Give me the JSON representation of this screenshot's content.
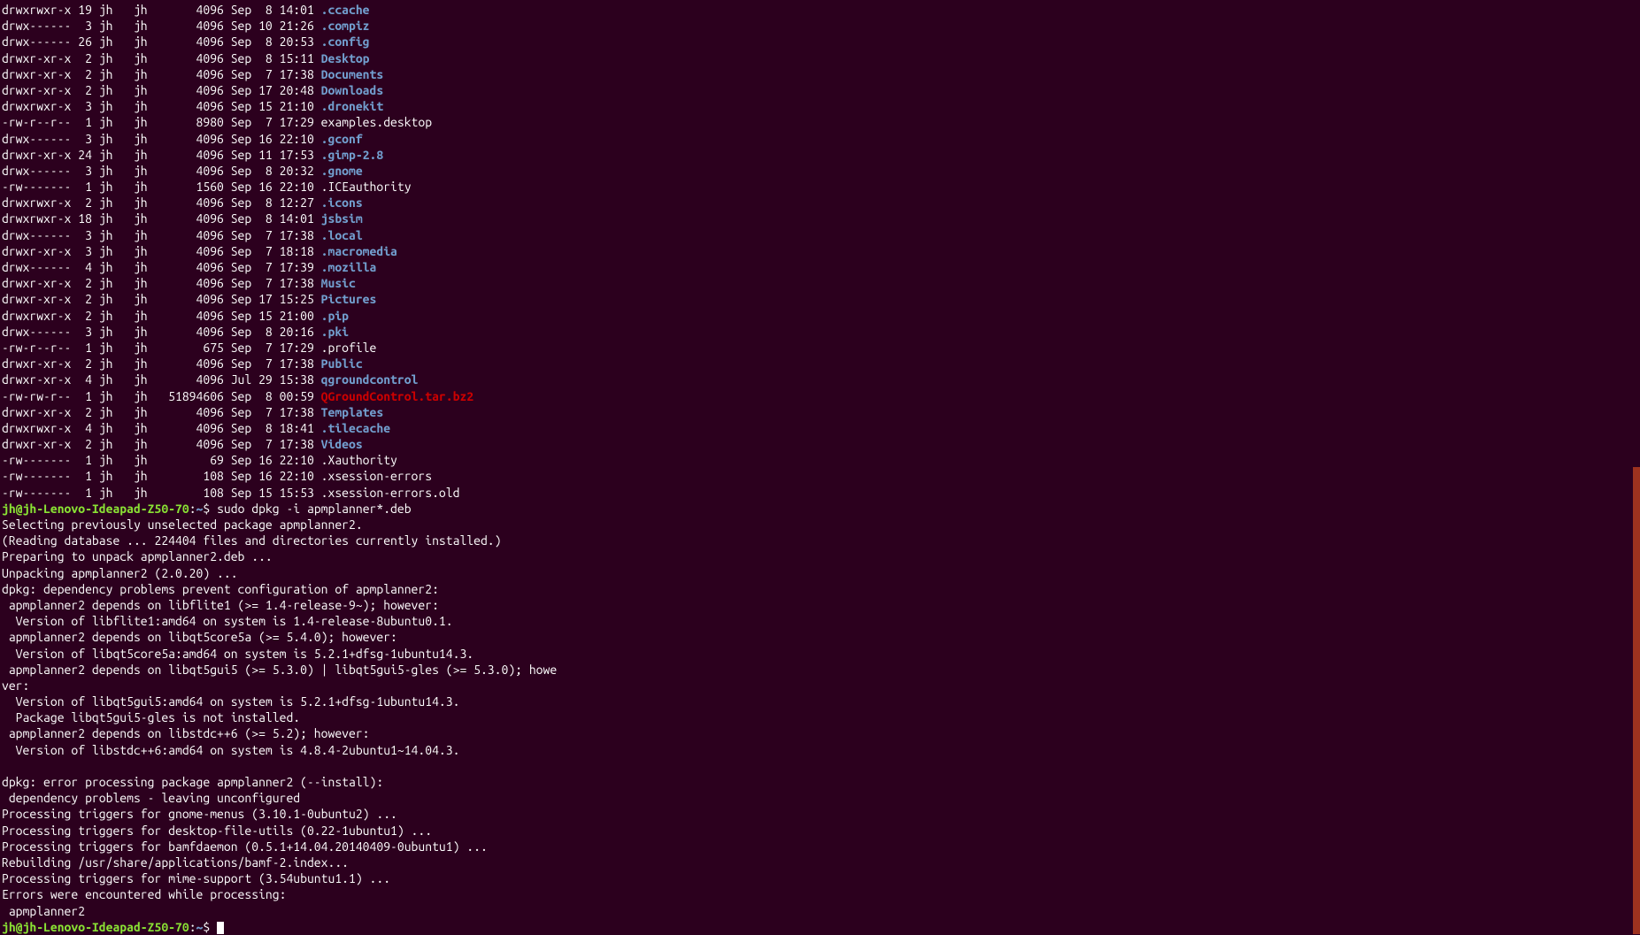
{
  "ls_entries": [
    {
      "perms": "drwxrwxr-x",
      "links": "19",
      "owner": "jh",
      "group": "jh",
      "size": "4096",
      "date": "Sep  8 14:01",
      "name": ".ccache",
      "type": "dir"
    },
    {
      "perms": "drwx------",
      "links": "3",
      "owner": "jh",
      "group": "jh",
      "size": "4096",
      "date": "Sep 10 21:26",
      "name": ".compiz",
      "type": "dir"
    },
    {
      "perms": "drwx------",
      "links": "26",
      "owner": "jh",
      "group": "jh",
      "size": "4096",
      "date": "Sep  8 20:53",
      "name": ".config",
      "type": "dir"
    },
    {
      "perms": "drwxr-xr-x",
      "links": "2",
      "owner": "jh",
      "group": "jh",
      "size": "4096",
      "date": "Sep  8 15:11",
      "name": "Desktop",
      "type": "dir"
    },
    {
      "perms": "drwxr-xr-x",
      "links": "2",
      "owner": "jh",
      "group": "jh",
      "size": "4096",
      "date": "Sep  7 17:38",
      "name": "Documents",
      "type": "dir"
    },
    {
      "perms": "drwxr-xr-x",
      "links": "2",
      "owner": "jh",
      "group": "jh",
      "size": "4096",
      "date": "Sep 17 20:48",
      "name": "Downloads",
      "type": "dir"
    },
    {
      "perms": "drwxrwxr-x",
      "links": "3",
      "owner": "jh",
      "group": "jh",
      "size": "4096",
      "date": "Sep 15 21:10",
      "name": ".dronekit",
      "type": "dir"
    },
    {
      "perms": "-rw-r--r--",
      "links": "1",
      "owner": "jh",
      "group": "jh",
      "size": "8980",
      "date": "Sep  7 17:29",
      "name": "examples.desktop",
      "type": "file"
    },
    {
      "perms": "drwx------",
      "links": "3",
      "owner": "jh",
      "group": "jh",
      "size": "4096",
      "date": "Sep 16 22:10",
      "name": ".gconf",
      "type": "dir"
    },
    {
      "perms": "drwxr-xr-x",
      "links": "24",
      "owner": "jh",
      "group": "jh",
      "size": "4096",
      "date": "Sep 11 17:53",
      "name": ".gimp-2.8",
      "type": "dir"
    },
    {
      "perms": "drwx------",
      "links": "3",
      "owner": "jh",
      "group": "jh",
      "size": "4096",
      "date": "Sep  8 20:32",
      "name": ".gnome",
      "type": "dir"
    },
    {
      "perms": "-rw-------",
      "links": "1",
      "owner": "jh",
      "group": "jh",
      "size": "1560",
      "date": "Sep 16 22:10",
      "name": ".ICEauthority",
      "type": "file"
    },
    {
      "perms": "drwxrwxr-x",
      "links": "2",
      "owner": "jh",
      "group": "jh",
      "size": "4096",
      "date": "Sep  8 12:27",
      "name": ".icons",
      "type": "dir"
    },
    {
      "perms": "drwxrwxr-x",
      "links": "18",
      "owner": "jh",
      "group": "jh",
      "size": "4096",
      "date": "Sep  8 14:01",
      "name": "jsbsim",
      "type": "dir"
    },
    {
      "perms": "drwx------",
      "links": "3",
      "owner": "jh",
      "group": "jh",
      "size": "4096",
      "date": "Sep  7 17:38",
      "name": ".local",
      "type": "dir"
    },
    {
      "perms": "drwxr-xr-x",
      "links": "3",
      "owner": "jh",
      "group": "jh",
      "size": "4096",
      "date": "Sep  7 18:18",
      "name": ".macromedia",
      "type": "dir"
    },
    {
      "perms": "drwx------",
      "links": "4",
      "owner": "jh",
      "group": "jh",
      "size": "4096",
      "date": "Sep  7 17:39",
      "name": ".mozilla",
      "type": "dir"
    },
    {
      "perms": "drwxr-xr-x",
      "links": "2",
      "owner": "jh",
      "group": "jh",
      "size": "4096",
      "date": "Sep  7 17:38",
      "name": "Music",
      "type": "dir"
    },
    {
      "perms": "drwxr-xr-x",
      "links": "2",
      "owner": "jh",
      "group": "jh",
      "size": "4096",
      "date": "Sep 17 15:25",
      "name": "Pictures",
      "type": "dir"
    },
    {
      "perms": "drwxrwxr-x",
      "links": "2",
      "owner": "jh",
      "group": "jh",
      "size": "4096",
      "date": "Sep 15 21:00",
      "name": ".pip",
      "type": "dir"
    },
    {
      "perms": "drwx------",
      "links": "3",
      "owner": "jh",
      "group": "jh",
      "size": "4096",
      "date": "Sep  8 20:16",
      "name": ".pki",
      "type": "dir"
    },
    {
      "perms": "-rw-r--r--",
      "links": "1",
      "owner": "jh",
      "group": "jh",
      "size": "675",
      "date": "Sep  7 17:29",
      "name": ".profile",
      "type": "file"
    },
    {
      "perms": "drwxr-xr-x",
      "links": "2",
      "owner": "jh",
      "group": "jh",
      "size": "4096",
      "date": "Sep  7 17:38",
      "name": "Public",
      "type": "dir"
    },
    {
      "perms": "drwxr-xr-x",
      "links": "4",
      "owner": "jh",
      "group": "jh",
      "size": "4096",
      "date": "Jul 29 15:38",
      "name": "qgroundcontrol",
      "type": "dir"
    },
    {
      "perms": "-rw-rw-r--",
      "links": "1",
      "owner": "jh",
      "group": "jh",
      "size": "51894606",
      "date": "Sep  8 00:59",
      "name": "QGroundControl.tar.bz2",
      "type": "archive"
    },
    {
      "perms": "drwxr-xr-x",
      "links": "2",
      "owner": "jh",
      "group": "jh",
      "size": "4096",
      "date": "Sep  7 17:38",
      "name": "Templates",
      "type": "dir"
    },
    {
      "perms": "drwxrwxr-x",
      "links": "4",
      "owner": "jh",
      "group": "jh",
      "size": "4096",
      "date": "Sep  8 18:41",
      "name": ".tilecache",
      "type": "dir"
    },
    {
      "perms": "drwxr-xr-x",
      "links": "2",
      "owner": "jh",
      "group": "jh",
      "size": "4096",
      "date": "Sep  7 17:38",
      "name": "Videos",
      "type": "dir"
    },
    {
      "perms": "-rw-------",
      "links": "1",
      "owner": "jh",
      "group": "jh",
      "size": "69",
      "date": "Sep 16 22:10",
      "name": ".Xauthority",
      "type": "file"
    },
    {
      "perms": "-rw-------",
      "links": "1",
      "owner": "jh",
      "group": "jh",
      "size": "108",
      "date": "Sep 16 22:10",
      "name": ".xsession-errors",
      "type": "file"
    },
    {
      "perms": "-rw-------",
      "links": "1",
      "owner": "jh",
      "group": "jh",
      "size": "108",
      "date": "Sep 15 15:53",
      "name": ".xsession-errors.old",
      "type": "file"
    }
  ],
  "prompt1": {
    "user_host": "jh@jh-Lenovo-Ideapad-Z50-70",
    "colon": ":",
    "path": "~",
    "dollar": "$ ",
    "command": "sudo dpkg -i apmplanner*.deb"
  },
  "dpkg_output": [
    "Selecting previously unselected package apmplanner2.",
    "(Reading database ... 224404 files and directories currently installed.)",
    "Preparing to unpack apmplanner2.deb ...",
    "Unpacking apmplanner2 (2.0.20) ...",
    "dpkg: dependency problems prevent configuration of apmplanner2:",
    " apmplanner2 depends on libflite1 (>= 1.4-release-9~); however:",
    "  Version of libflite1:amd64 on system is 1.4-release-8ubuntu0.1.",
    " apmplanner2 depends on libqt5core5a (>= 5.4.0); however:",
    "  Version of libqt5core5a:amd64 on system is 5.2.1+dfsg-1ubuntu14.3.",
    " apmplanner2 depends on libqt5gui5 (>= 5.3.0) | libqt5gui5-gles (>= 5.3.0); howe",
    "ver:",
    "  Version of libqt5gui5:amd64 on system is 5.2.1+dfsg-1ubuntu14.3.",
    "  Package libqt5gui5-gles is not installed.",
    " apmplanner2 depends on libstdc++6 (>= 5.2); however:",
    "  Version of libstdc++6:amd64 on system is 4.8.4-2ubuntu1~14.04.3.",
    "",
    "dpkg: error processing package apmplanner2 (--install):",
    " dependency problems - leaving unconfigured",
    "Processing triggers for gnome-menus (3.10.1-0ubuntu2) ...",
    "Processing triggers for desktop-file-utils (0.22-1ubuntu1) ...",
    "Processing triggers for bamfdaemon (0.5.1+14.04.20140409-0ubuntu1) ...",
    "Rebuilding /usr/share/applications/bamf-2.index...",
    "Processing triggers for mime-support (3.54ubuntu1.1) ...",
    "Errors were encountered while processing:",
    " apmplanner2"
  ],
  "prompt2": {
    "user_host": "jh@jh-Lenovo-Ideapad-Z50-70",
    "colon": ":",
    "path": "~",
    "dollar": "$ "
  }
}
